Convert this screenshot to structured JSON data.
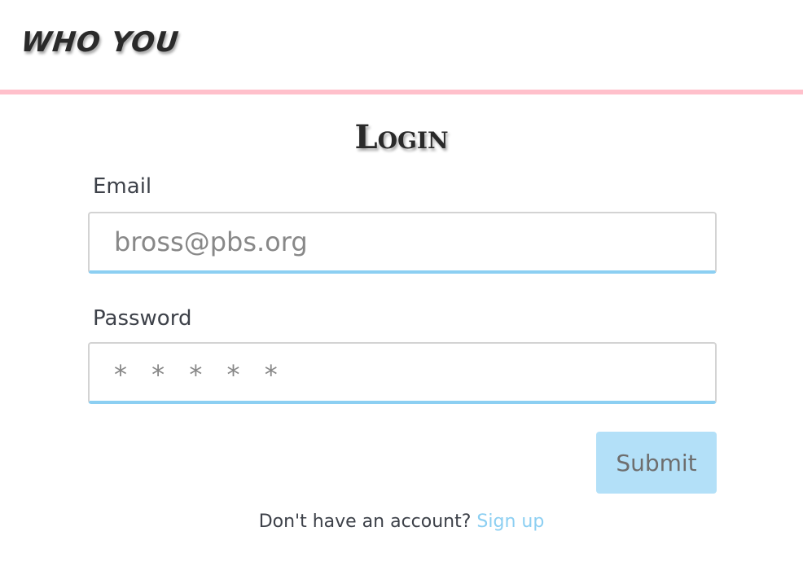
{
  "header": {
    "brand": "WHO YOU",
    "rule_color": "#ffc0cb"
  },
  "form": {
    "title": "Login",
    "email": {
      "label": "Email",
      "placeholder": "bross@pbs.org"
    },
    "password": {
      "label": "Password",
      "placeholder": "* * * * *"
    },
    "submit_label": "Submit"
  },
  "footer": {
    "prompt": "Don't have an account?",
    "link_label": "Sign up"
  },
  "colors": {
    "accent": "#8ccff2",
    "button_bg": "#b3e0f8",
    "header_rule": "#ffc0cb"
  }
}
